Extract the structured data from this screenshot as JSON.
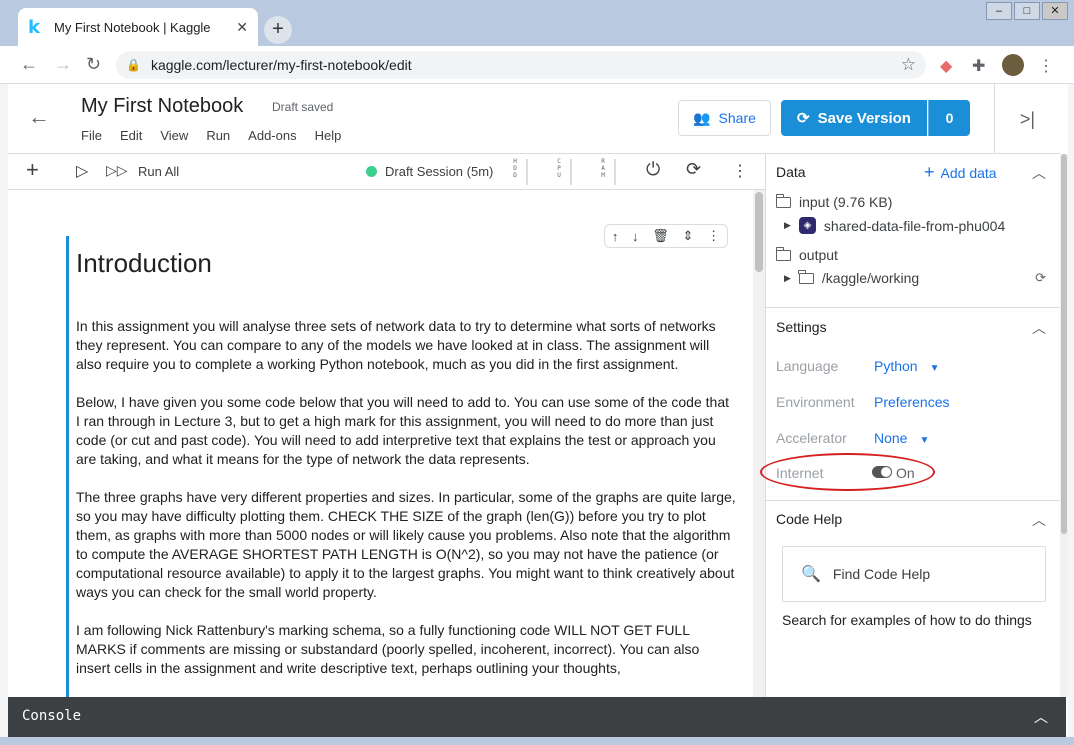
{
  "browser": {
    "tab_title": "My First Notebook | Kaggle",
    "tab_logo": "k",
    "url": "kaggle.com/lecturer/my-first-notebook/edit"
  },
  "header": {
    "title": "My First Notebook",
    "status": "Draft saved",
    "menu": [
      "File",
      "Edit",
      "View",
      "Run",
      "Add-ons",
      "Help"
    ],
    "share_label": "Share",
    "save_label": "Save Version",
    "save_count": "0"
  },
  "toolbar": {
    "run_all_label": "Run All",
    "session_label": "Draft Session (5m)",
    "meters": [
      "H\nD\nD",
      "C\nP\nU",
      "R\nA\nM"
    ]
  },
  "cell": {
    "heading": "Introduction",
    "paragraphs": [
      "In this assignment you will analyse three sets of network data to try to determine what sorts of networks they represent. You can compare to any of the models we have looked at in class. The assignment will also require you to complete a working Python notebook, much as you did in the first assignment.",
      "Below, I have given you some code below that you will need to add to. You can use some of the code that I ran through in Lecture 3, but to get a high mark for this assignment, you will need to do more than just code (or cut and past code). You will need to add interpretive text that explains the test or approach you are taking, and what it means for the type of network the data represents.",
      "The three graphs have very different properties and sizes. In particular, some of the graphs are quite large, so you may have difficulty plotting them. CHECK THE SIZE of the graph (len(G)) before you try to plot them, as graphs with more than 5000 nodes or will likely cause you problems. Also note that the algorithm to compute the AVERAGE SHORTEST PATH LENGTH is O(N^2), so you may not have the patience (or computational resource available) to apply it to the largest graphs. You might want to think creatively about ways you can check for the small world property.",
      "I am following Nick Rattenbury's marking schema, so a fully functioning code WILL NOT GET FULL MARKS if comments are missing or substandard (poorly spelled, incoherent, incorrect). You can also insert cells in the assignment and write descriptive text, perhaps outlining your thoughts,"
    ]
  },
  "panel": {
    "data_title": "Data",
    "add_data_label": "Add data",
    "input_label": "input (9.76 KB)",
    "dataset_name": "shared-data-file-from-phu004",
    "output_label": "output",
    "working_dir": "/kaggle/working",
    "settings_title": "Settings",
    "settings": [
      {
        "label": "Language",
        "value": "Python"
      },
      {
        "label": "Environment",
        "value": "Preferences"
      },
      {
        "label": "Accelerator",
        "value": "None"
      }
    ],
    "internet_label": "Internet",
    "internet_value": "On",
    "code_help_title": "Code Help",
    "find_code_help": "Find Code Help",
    "code_help_desc": "Search for examples of how to do things"
  },
  "console": {
    "label": "Console"
  },
  "colors": {
    "accent": "#1a8fd8",
    "link": "#1a73e8",
    "session_dot": "#3ecf8e",
    "highlight": "#d62020"
  }
}
